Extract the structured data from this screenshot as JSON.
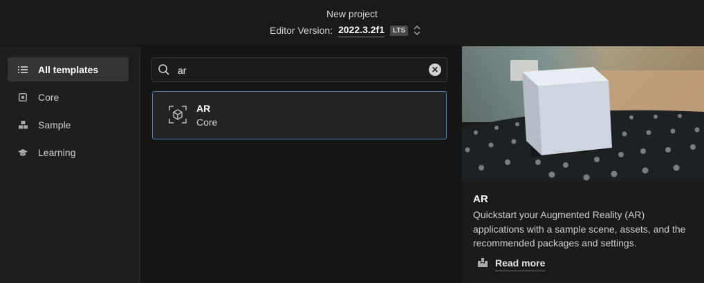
{
  "header": {
    "title": "New project",
    "editor_version_label": "Editor Version:",
    "editor_version_value": "2022.3.2f1",
    "version_badge": "LTS"
  },
  "sidebar": {
    "items": [
      {
        "label": "All templates",
        "icon": "list-icon",
        "active": true
      },
      {
        "label": "Core",
        "icon": "core-square-icon",
        "active": false
      },
      {
        "label": "Sample",
        "icon": "sample-blocks-icon",
        "active": false
      },
      {
        "label": "Learning",
        "icon": "graduation-cap-icon",
        "active": false
      }
    ]
  },
  "search": {
    "value": "ar",
    "placeholder": ""
  },
  "results": [
    {
      "title": "AR",
      "category": "Core",
      "icon": "ar-cube-icon"
    }
  ],
  "details": {
    "title": "AR",
    "description": "Quickstart your Augmented Reality (AR) applications with a sample scene, assets, and the recommended packages and settings.",
    "read_more_label": "Read more",
    "read_more_icon": "book-icon"
  },
  "colors": {
    "selection_border": "#4a7fc0",
    "active_sidebar_bg": "#343434",
    "background": "#161616"
  }
}
